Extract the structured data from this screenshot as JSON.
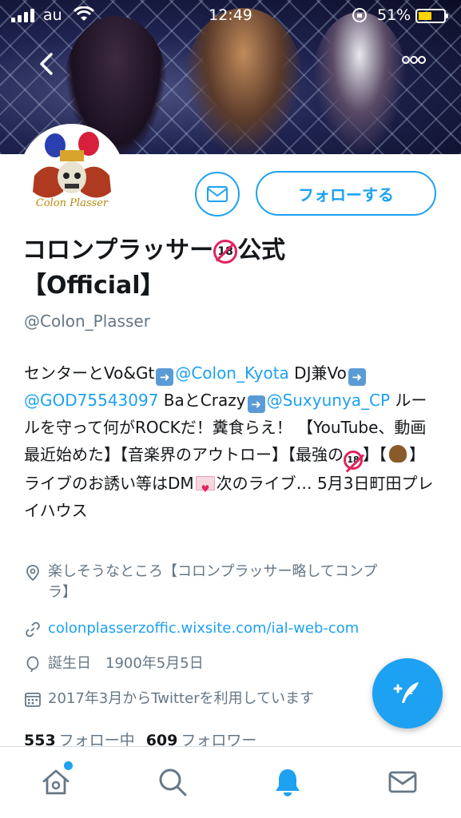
{
  "status_bar": {
    "carrier": "au",
    "time": "12:49",
    "battery_percent": "51%"
  },
  "header": {
    "back_icon": "chevron-left-icon",
    "more_icon": "ellipsis-icon"
  },
  "profile": {
    "name_line1": "コロンプラッサー",
    "name_badge": "18",
    "name_line1_suffix": "公式",
    "name_line2": "【Official】",
    "handle": "@Colon_Plasser",
    "follow_label": "フォローする",
    "bio": {
      "t1": "センターとVo&Gt",
      "link1": "@Colon_Kyota",
      "t2": " DJ兼Vo",
      "link2": "@GOD75543097",
      "t3": " BaとCrazy",
      "link3": "@Suxyunya_CP",
      "t4": " ルールを守って何がROCKだ！糞食らえ！ 【YouTube、動画最近始めた】【音楽界のアウトロー】【最強の",
      "t5": "】【",
      "t6": "】 ライブのお誘い等はDM",
      "t7": "次のライブ… 5月3日町田プレイハウス"
    },
    "location": "楽しそうなところ【コロンプラッサー略してコンプラ】",
    "website": "colonplasserzoffic.wixsite.com/ial-web-com",
    "birthday": "誕生日　1900年5月5日",
    "joined": "2017年3月からTwitterを利用しています",
    "following_count": "553",
    "following_label": "フォロー中",
    "followers_count": "609",
    "followers_label": "フォロワー"
  },
  "colors": {
    "accent": "#1da1f2",
    "text": "#14171a",
    "secondary": "#657786"
  }
}
